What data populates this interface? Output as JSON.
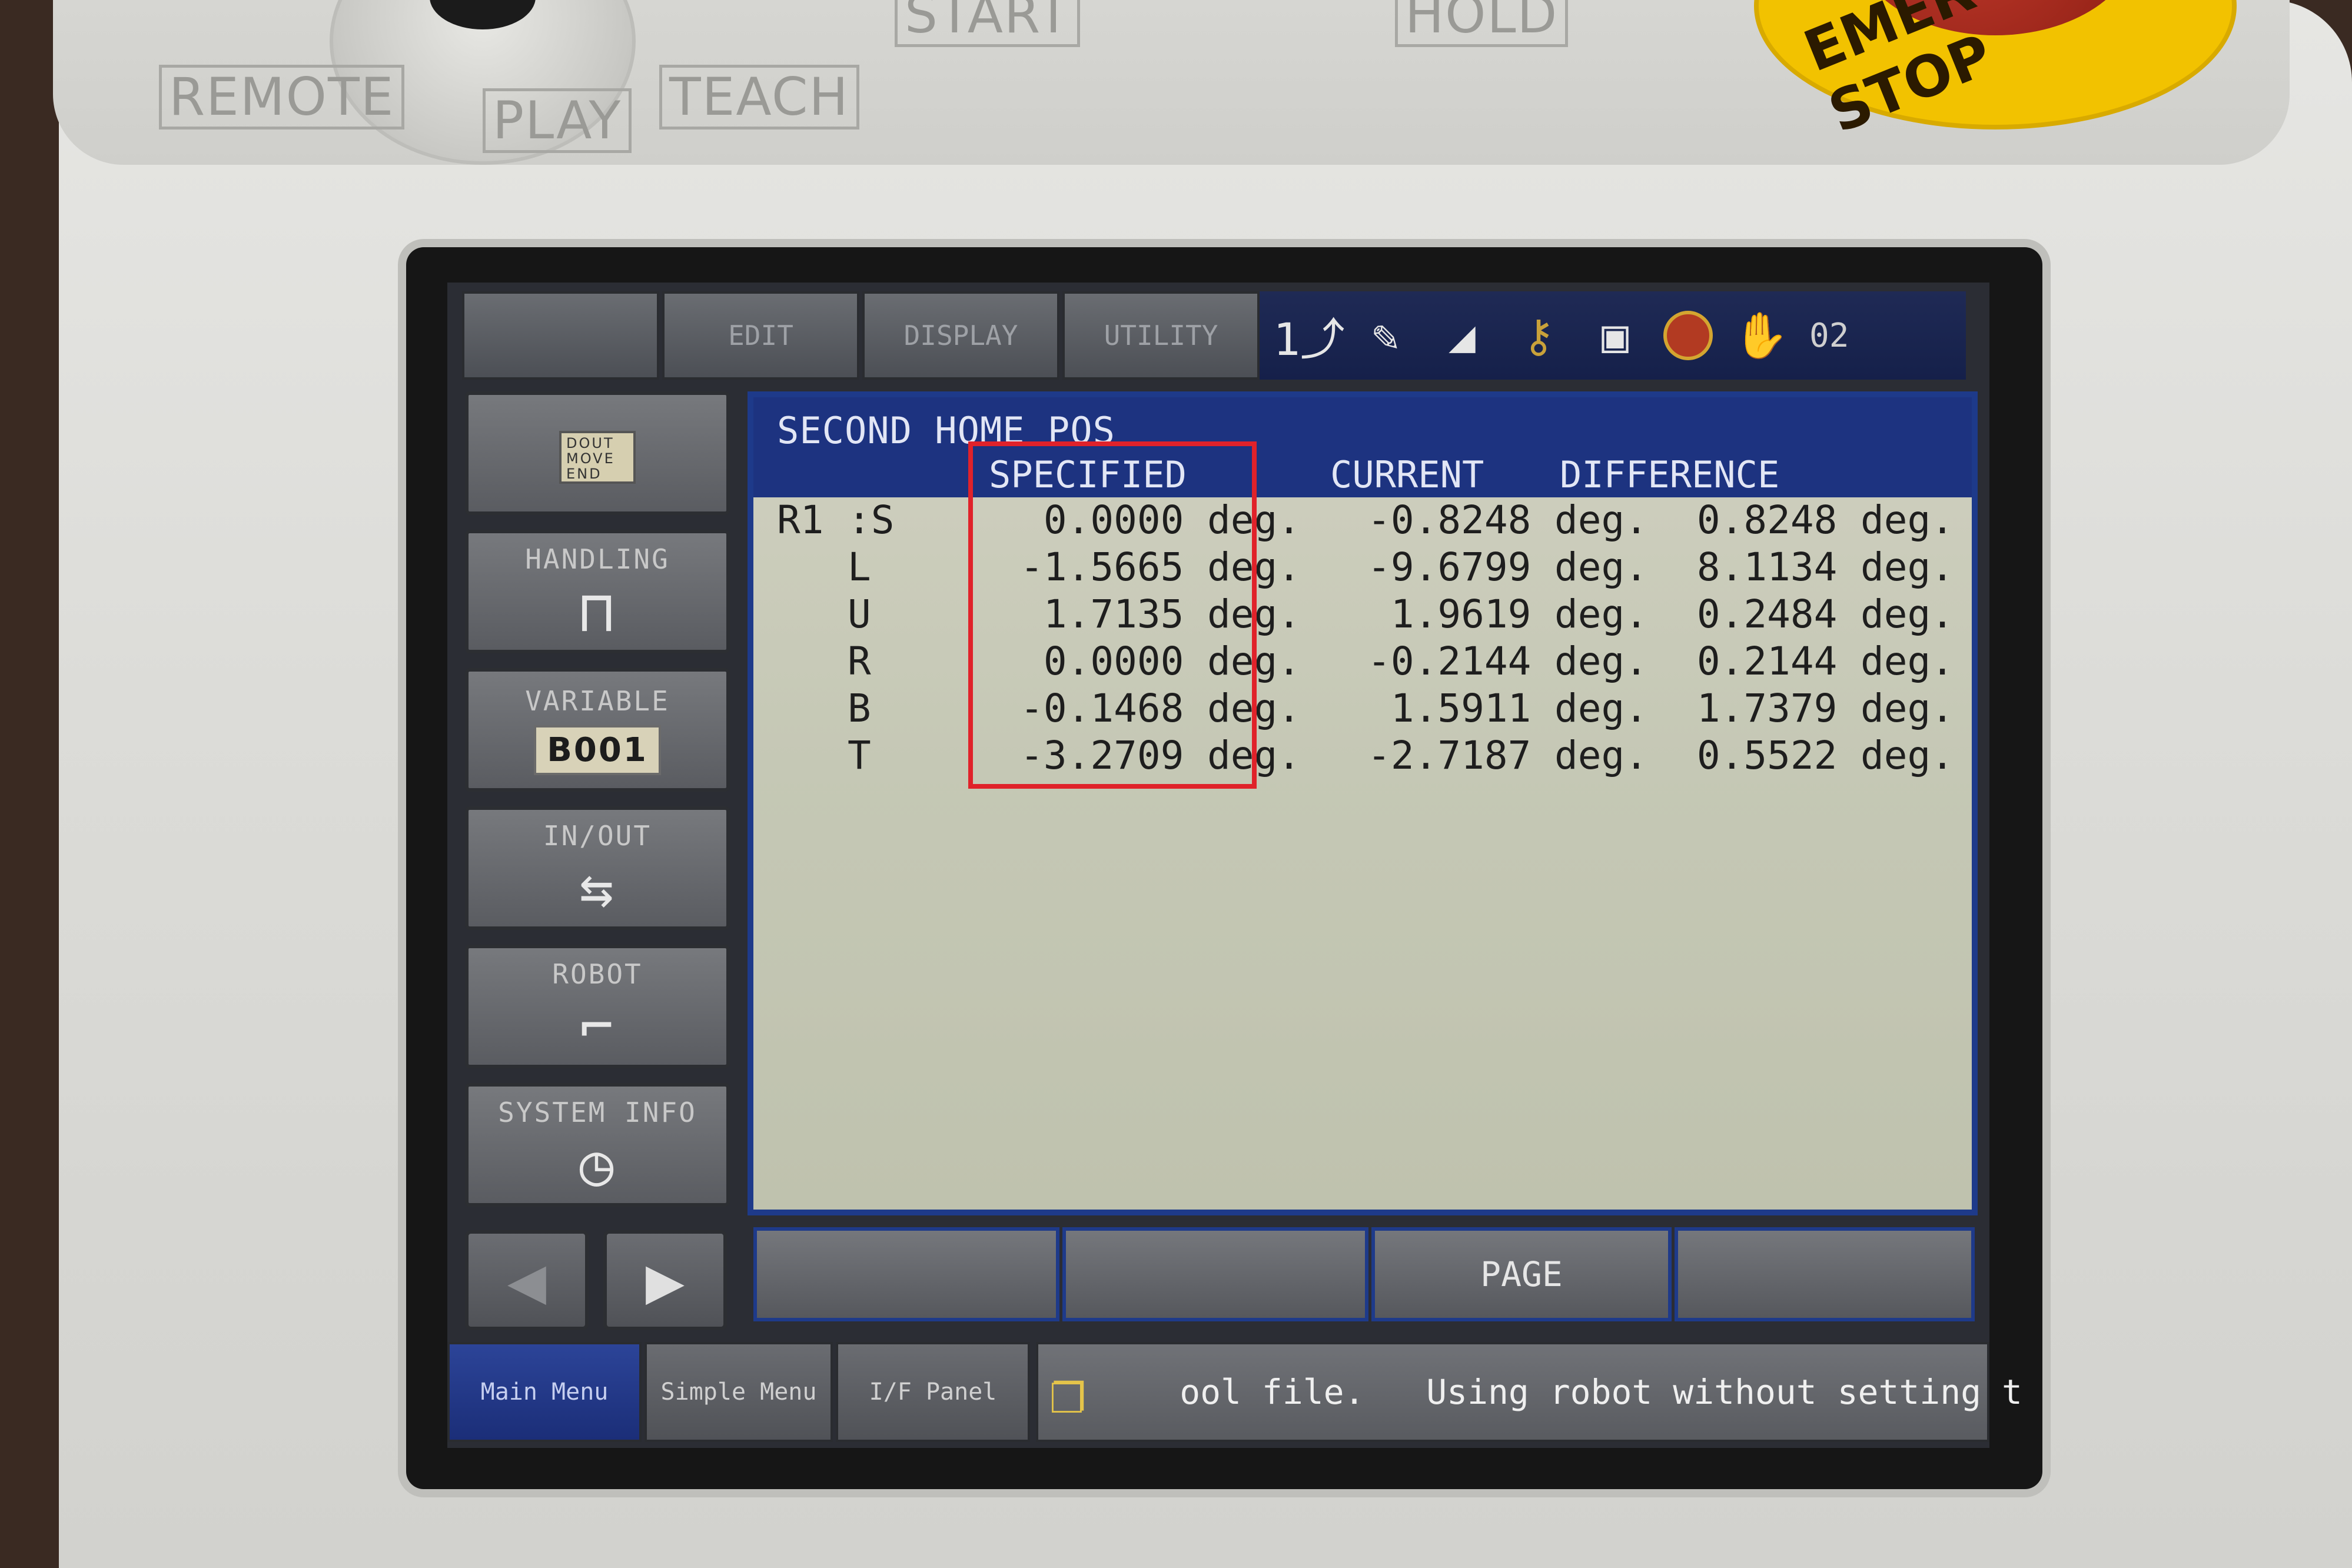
{
  "pendant_labels": {
    "remote": "REMOTE",
    "play": "PLAY",
    "teach": "TEACH",
    "start": "START",
    "hold": "HOLD",
    "emergency_stop": "EMERGENCY STOP"
  },
  "top_menu": {
    "tabs": [
      "",
      "EDIT",
      "DISPLAY",
      "UTILITY"
    ]
  },
  "status_bar": {
    "icons": [
      "step-icon",
      "edit-mode-icon",
      "signal-icon",
      "key-icon",
      "clipboard-icon",
      "alarm-icon",
      "hand-icon"
    ],
    "step_glyph": "1⤴",
    "number": "02"
  },
  "side_menu": {
    "items": [
      {
        "label": "",
        "icon": "job-doc-icon",
        "icon_text": "DOUT MOVE END"
      },
      {
        "label": "HANDLING",
        "icon": "gripper-icon"
      },
      {
        "label": "VARIABLE",
        "icon": "variable-icon",
        "badge": "B001"
      },
      {
        "label": "IN/OUT",
        "icon": "in-out-icon"
      },
      {
        "label": "ROBOT",
        "icon": "robot-arm-icon"
      },
      {
        "label": "SYSTEM INFO",
        "icon": "system-info-icon"
      }
    ]
  },
  "screen": {
    "title": "SECOND HOME POS",
    "columns": {
      "specified": "SPECIFIED",
      "current": "CURRENT",
      "difference": "DIFFERENCE"
    },
    "robot": "R1",
    "rows": [
      {
        "axis": ":S",
        "specified": "0.0000 deg.",
        "current": "-0.8248 deg.",
        "difference": "0.8248 deg."
      },
      {
        "axis": "L",
        "specified": "-1.5665 deg.",
        "current": "-9.6799 deg.",
        "difference": "8.1134 deg."
      },
      {
        "axis": "U",
        "specified": "1.7135 deg.",
        "current": "1.9619 deg.",
        "difference": "0.2484 deg."
      },
      {
        "axis": "R",
        "specified": "0.0000 deg.",
        "current": "-0.2144 deg.",
        "difference": "0.2144 deg."
      },
      {
        "axis": "B",
        "specified": "-0.1468 deg.",
        "current": "1.5911 deg.",
        "difference": "1.7379 deg."
      },
      {
        "axis": "T",
        "specified": "-3.2709 deg.",
        "current": "-2.7187 deg.",
        "difference": "0.5522 deg."
      }
    ]
  },
  "function_keys": [
    "",
    "",
    "PAGE",
    ""
  ],
  "bottom_bar": {
    "main_menu": "Main Menu",
    "simple_menu": "Simple Menu",
    "if_panel": "I/F Panel",
    "message": "ool file.   Using robot without setting t"
  },
  "colors": {
    "highlight": "#e0222a",
    "panel_header": "#1d3380",
    "panel_bg": "#c5c8b5"
  }
}
